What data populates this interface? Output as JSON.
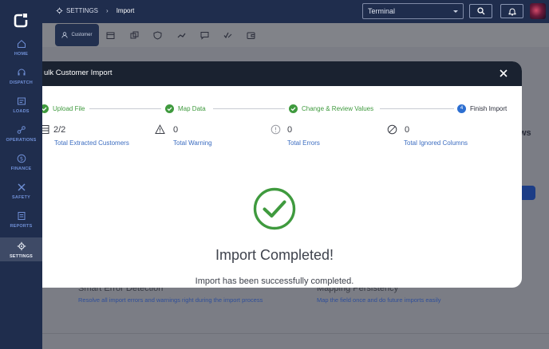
{
  "sidebar": {
    "items": [
      {
        "label": "HOME",
        "icon": "home-icon"
      },
      {
        "label": "DISPATCH",
        "icon": "headset-icon"
      },
      {
        "label": "LOADS",
        "icon": "loads-icon"
      },
      {
        "label": "OPERATIONS",
        "icon": "operations-icon"
      },
      {
        "label": "FINANCE",
        "icon": "dollar-icon"
      },
      {
        "label": "SAFETY",
        "icon": "tools-icon"
      },
      {
        "label": "REPORTS",
        "icon": "report-icon"
      },
      {
        "label": "SETTINGS",
        "icon": "gear-icon",
        "active": true
      }
    ]
  },
  "topbar": {
    "breadcrumb_root": "SETTINGS",
    "breadcrumb_current": "Import",
    "terminal_select": "Terminal"
  },
  "subbar": {
    "active_tab": "Customer"
  },
  "background": {
    "feature1_title": "Smart Error Detection",
    "feature1_desc": "Resolve all import errors and warnings right during the import process",
    "feature2_title": "Mapping Persistency",
    "feature2_desc": "Map the field once and do future imports easily",
    "partial_heading": "ws"
  },
  "modal": {
    "title": "ulk Customer Import",
    "steps": [
      {
        "label": "Upload File",
        "state": "done"
      },
      {
        "label": "Map Data",
        "state": "done"
      },
      {
        "label": "Change & Review Values",
        "state": "done"
      },
      {
        "label": "Finish Import",
        "state": "current",
        "number": "4"
      }
    ],
    "stats": [
      {
        "value": "2/2",
        "caption": "Total Extracted Customers",
        "icon": "list-icon"
      },
      {
        "value": "0",
        "caption": "Total Warning",
        "icon": "warning-icon"
      },
      {
        "value": "0",
        "caption": "Total Errors",
        "icon": "error-icon"
      },
      {
        "value": "0",
        "caption": "Total Ignored Columns",
        "icon": "ignore-icon"
      }
    ],
    "completed_title": "Import Completed!",
    "completed_subtitle": "Import has been successfully completed."
  },
  "colors": {
    "sidebar_bg": "#1f2d4d",
    "success_green": "#3f9a3e",
    "accent_blue": "#2d6fd1",
    "link_blue": "#3b6cc0",
    "modal_header": "#1a2230"
  }
}
